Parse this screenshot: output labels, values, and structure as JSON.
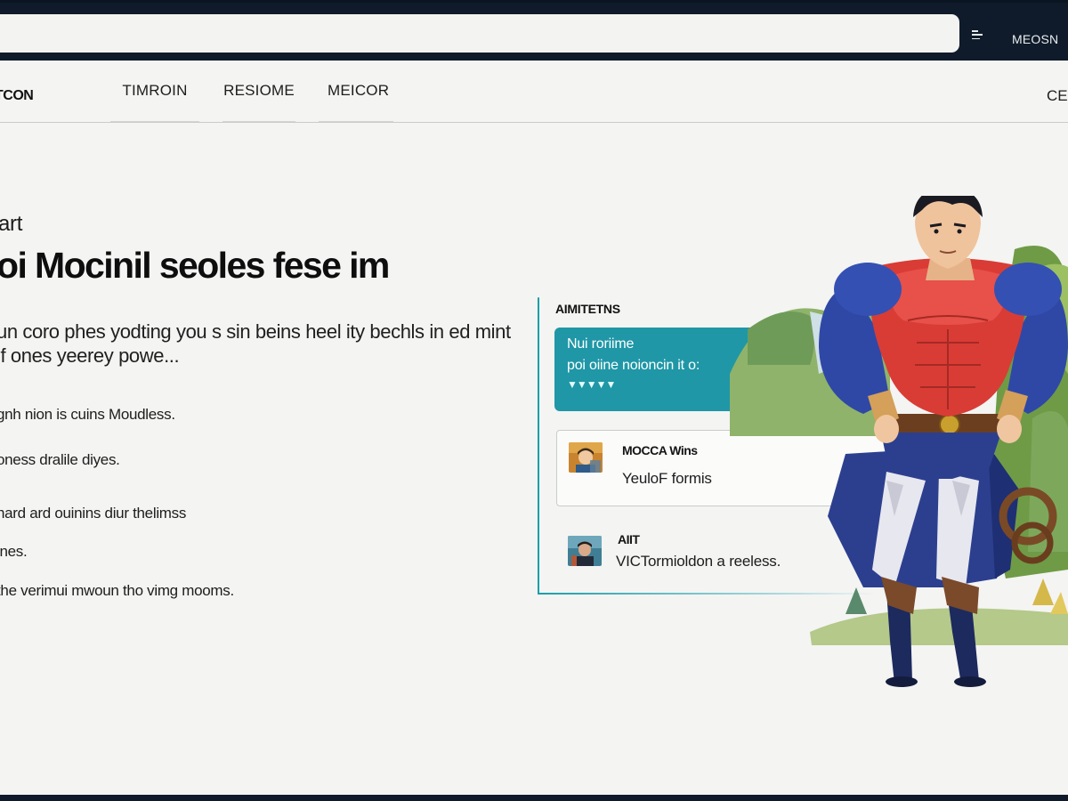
{
  "topbar": {
    "address_text": "",
    "action_label": "MEOSN"
  },
  "nav": {
    "brand": "TCON",
    "tabs": [
      {
        "label": "TIMROIN"
      },
      {
        "label": "RESIOME"
      },
      {
        "label": "MEICOR"
      }
    ],
    "right_label": "CE"
  },
  "hero": {
    "eyebrow": "art",
    "headline": "oi Mocinil seoles fese im",
    "lede": "un coro phes yodting you s sin beins heel ity bechls in ed mint if ones yeerey powe...",
    "bullets": [
      "gnh nion is cuins Moudless.",
      "oness dralile diyes.",
      "nard ard ouinins diur thelimss",
      "ines.",
      "the verimui mwoun tho vimg mooms."
    ]
  },
  "panel": {
    "title": "AIMITETNS",
    "highlight": {
      "line1": "Nui roriime",
      "line2": "poi oiine noioncin it o:",
      "rating": "▼▼▼▼▼"
    },
    "messages": [
      {
        "name": "MOCCA Wins",
        "text": "YeuloF formis"
      },
      {
        "name": "AIIT",
        "text": "VICTormioldon a reeless."
      }
    ]
  },
  "colors": {
    "chrome": "#0f1b2a",
    "accent": "#1f97a6",
    "background": "#f4f4f2"
  }
}
